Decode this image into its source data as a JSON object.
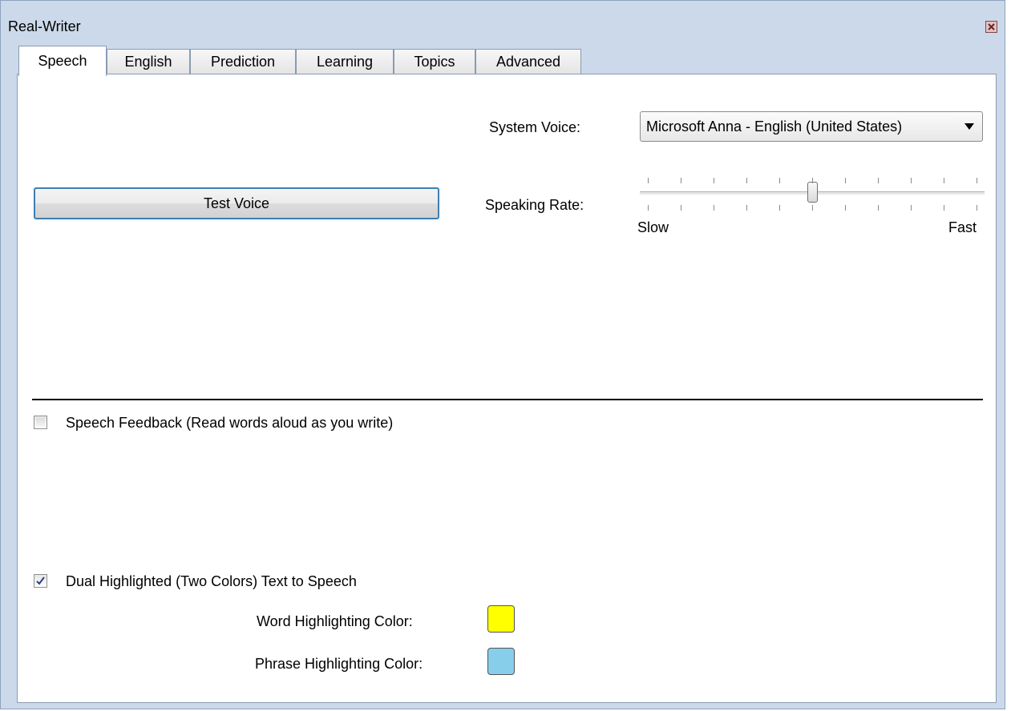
{
  "window": {
    "title": "Real-Writer",
    "close_icon": "close-icon"
  },
  "tabs": [
    {
      "label": "Speech",
      "active": true
    },
    {
      "label": "English",
      "active": false
    },
    {
      "label": "Prediction",
      "active": false
    },
    {
      "label": "Learning",
      "active": false
    },
    {
      "label": "Topics",
      "active": false
    },
    {
      "label": "Advanced",
      "active": false
    }
  ],
  "speech": {
    "system_voice_label": "System Voice:",
    "system_voice_value": "Microsoft Anna - English (United States)",
    "test_voice_label": "Test Voice",
    "speaking_rate_label": "Speaking Rate:",
    "speaking_rate_min_label": "Slow",
    "speaking_rate_max_label": "Fast",
    "speaking_rate_level": 0.5,
    "speech_feedback_label": "Speech Feedback (Read words aloud as you write)",
    "speech_feedback_checked": false,
    "dual_highlight_label": "Dual Highlighted (Two Colors) Text to Speech",
    "dual_highlight_checked": true,
    "word_color_label": "Word Highlighting Color:",
    "word_color": "#ffff00",
    "phrase_color_label": "Phrase Highlighting Color:",
    "phrase_color": "#87ceeb"
  }
}
